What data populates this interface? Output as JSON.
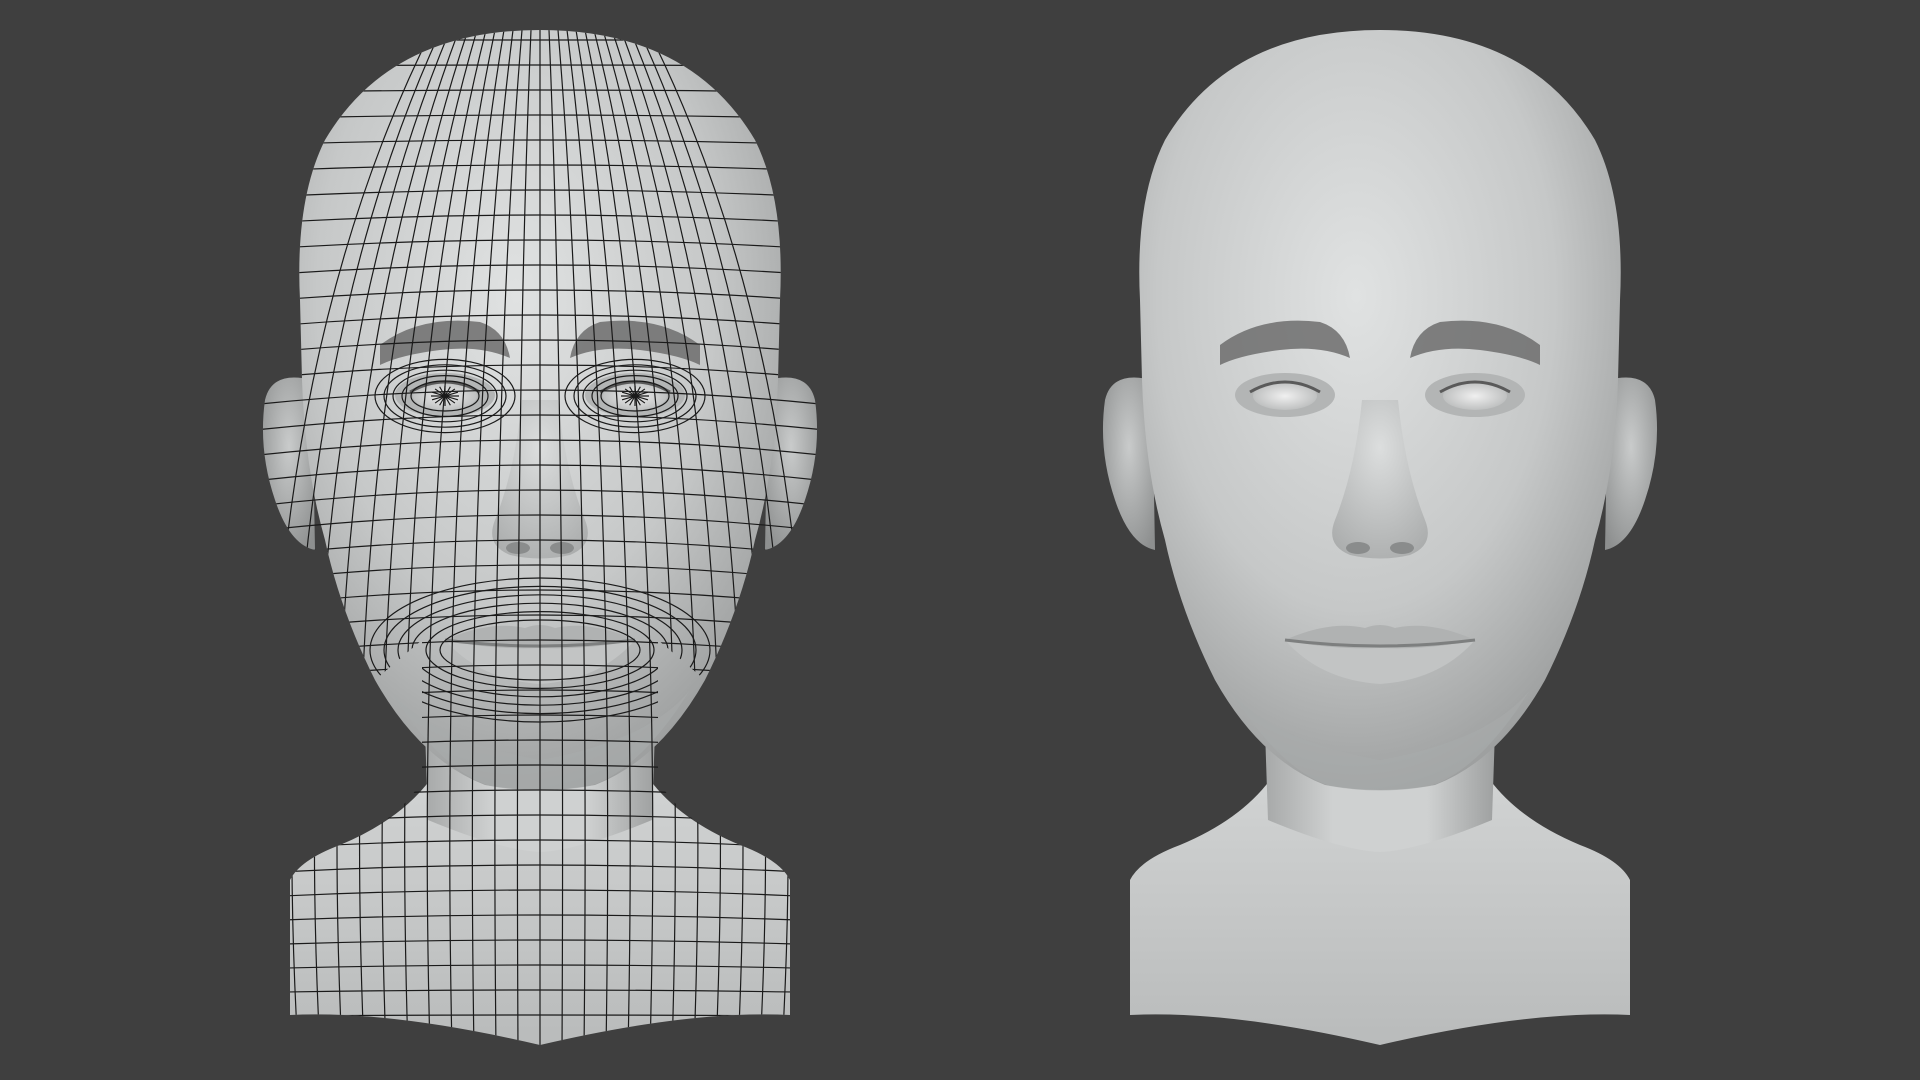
{
  "scene": {
    "background_color": "#3f3f3f",
    "mesh_color": "#c9cbcb",
    "wire_color": "#1a1a1a",
    "brow_color": "#6d6d6d"
  },
  "models": [
    {
      "id": "wireframe-head",
      "display_mode": "wireframe-on-shaded"
    },
    {
      "id": "shaded-head",
      "display_mode": "smooth-shaded"
    }
  ]
}
